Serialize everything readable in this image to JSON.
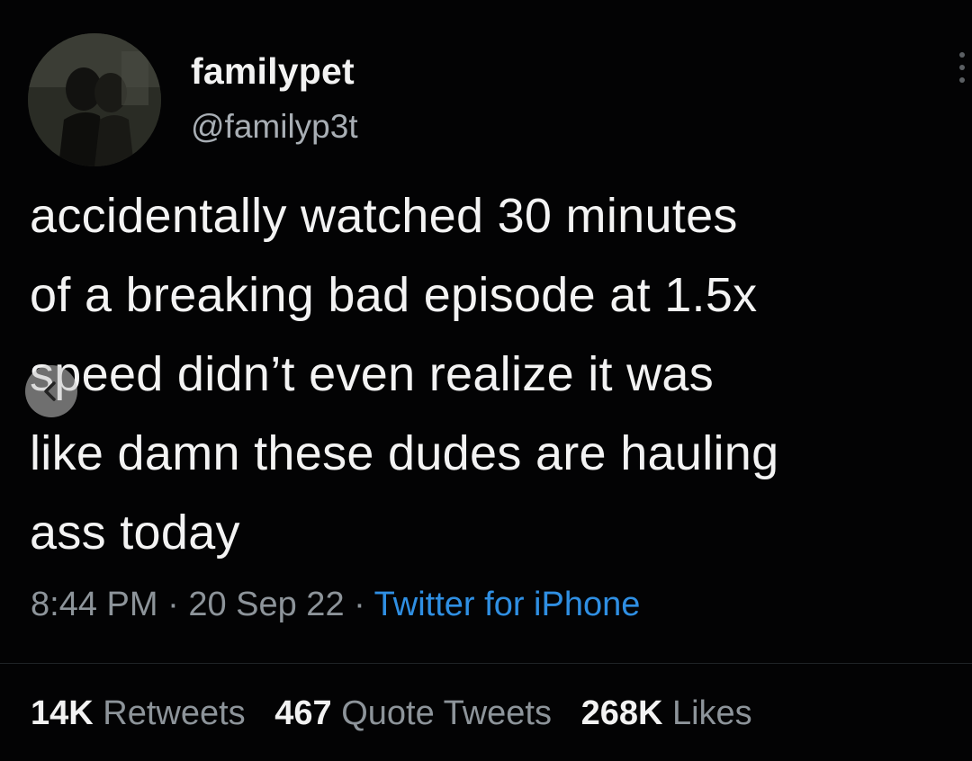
{
  "author": {
    "display_name": "familypet",
    "handle": "@familyp3t",
    "avatar_icon": "user-avatar-photo"
  },
  "tweet": {
    "lines": [
      "accidentally watched 30 minutes",
      "of a breaking bad episode at 1.5x",
      "speed didn’t even realize it was",
      "like damn these dudes are hauling",
      "ass today"
    ],
    "time": "8:44 PM",
    "separator": "·",
    "date": "20 Sep 22",
    "source": "Twitter for iPhone"
  },
  "stats": {
    "retweets_count": "14K",
    "retweets_label": "Retweets",
    "quotes_count": "467",
    "quotes_label": "Quote Tweets",
    "likes_count": "268K",
    "likes_label": "Likes"
  },
  "colors": {
    "background": "#030304",
    "text": "#f3f3f3",
    "secondary": "#8d949a",
    "link": "#2f8fe3"
  }
}
